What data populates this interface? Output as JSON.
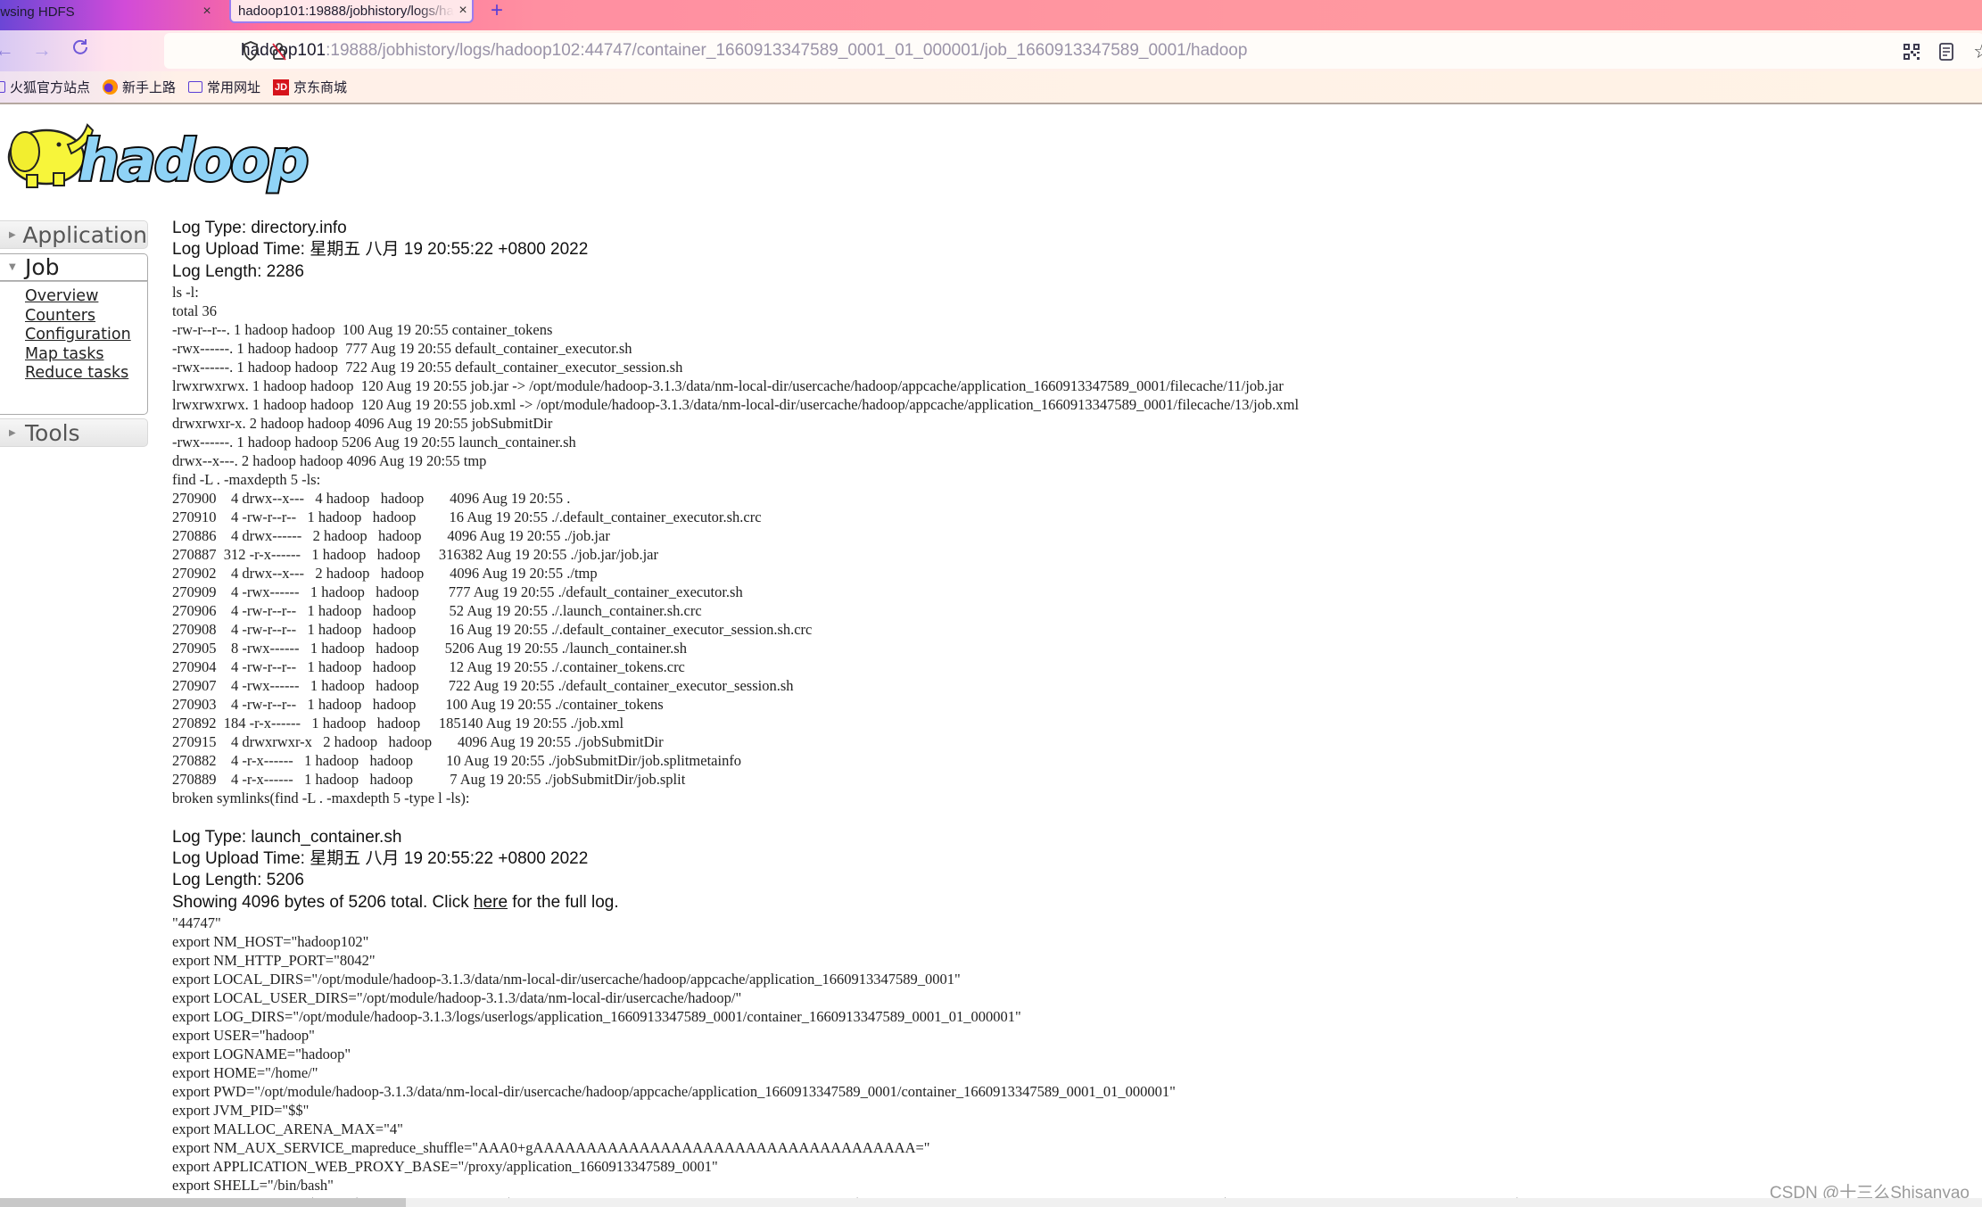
{
  "browser": {
    "tabs": [
      {
        "title": "owsing HDFS",
        "active": false
      },
      {
        "title": "hadoop101:19888/jobhistory/logs/hadoop102:44747/container_1660913347589_0001_01_000001/job_1660913347589_0001/hadoop",
        "active": true
      }
    ],
    "new_tab_label": "+",
    "close_glyph": "×",
    "url": {
      "host": "hadoop101",
      "path": ":19888/jobhistory/logs/hadoop102:44747/container_1660913347589_0001_01_000001/job_1660913347589_0001/hadoop"
    },
    "bookmarks": [
      {
        "label": "火狐官方站点",
        "icon": "folder-icon"
      },
      {
        "label": "新手上路",
        "icon": "firefox-icon"
      },
      {
        "label": "常用网址",
        "icon": "folder-icon"
      },
      {
        "label": "京东商城",
        "icon": "jd-icon",
        "icon_text": "JD"
      }
    ]
  },
  "sidebar": {
    "sections": [
      {
        "label": "Application",
        "expanded": false
      },
      {
        "label": "Job",
        "expanded": true,
        "links": [
          "Overview",
          "Counters",
          "Configuration",
          "Map tasks",
          "Reduce tasks"
        ]
      },
      {
        "label": "Tools",
        "expanded": false
      }
    ]
  },
  "logs": [
    {
      "type": "Log Type: directory.info",
      "upload_time": "Log Upload Time: 星期五 八月 19 20:55:22 +0800 2022",
      "length": "Log Length: 2286",
      "body": "ls -l:\ntotal 36\n-rw-r--r--. 1 hadoop hadoop  100 Aug 19 20:55 container_tokens\n-rwx------. 1 hadoop hadoop  777 Aug 19 20:55 default_container_executor.sh\n-rwx------. 1 hadoop hadoop  722 Aug 19 20:55 default_container_executor_session.sh\nlrwxrwxrwx. 1 hadoop hadoop  120 Aug 19 20:55 job.jar -> /opt/module/hadoop-3.1.3/data/nm-local-dir/usercache/hadoop/appcache/application_1660913347589_0001/filecache/11/job.jar\nlrwxrwxrwx. 1 hadoop hadoop  120 Aug 19 20:55 job.xml -> /opt/module/hadoop-3.1.3/data/nm-local-dir/usercache/hadoop/appcache/application_1660913347589_0001/filecache/13/job.xml\ndrwxrwxr-x. 2 hadoop hadoop 4096 Aug 19 20:55 jobSubmitDir\n-rwx------. 1 hadoop hadoop 5206 Aug 19 20:55 launch_container.sh\ndrwx--x---. 2 hadoop hadoop 4096 Aug 19 20:55 tmp\nfind -L . -maxdepth 5 -ls:\n270900    4 drwx--x---   4 hadoop   hadoop       4096 Aug 19 20:55 .\n270910    4 -rw-r--r--   1 hadoop   hadoop         16 Aug 19 20:55 ./.default_container_executor.sh.crc\n270886    4 drwx------   2 hadoop   hadoop       4096 Aug 19 20:55 ./job.jar\n270887  312 -r-x------   1 hadoop   hadoop     316382 Aug 19 20:55 ./job.jar/job.jar\n270902    4 drwx--x---   2 hadoop   hadoop       4096 Aug 19 20:55 ./tmp\n270909    4 -rwx------   1 hadoop   hadoop        777 Aug 19 20:55 ./default_container_executor.sh\n270906    4 -rw-r--r--   1 hadoop   hadoop         52 Aug 19 20:55 ./.launch_container.sh.crc\n270908    4 -rw-r--r--   1 hadoop   hadoop         16 Aug 19 20:55 ./.default_container_executor_session.sh.crc\n270905    8 -rwx------   1 hadoop   hadoop       5206 Aug 19 20:55 ./launch_container.sh\n270904    4 -rw-r--r--   1 hadoop   hadoop         12 Aug 19 20:55 ./.container_tokens.crc\n270907    4 -rwx------   1 hadoop   hadoop        722 Aug 19 20:55 ./default_container_executor_session.sh\n270903    4 -rw-r--r--   1 hadoop   hadoop        100 Aug 19 20:55 ./container_tokens\n270892  184 -r-x------   1 hadoop   hadoop     185140 Aug 19 20:55 ./job.xml\n270915    4 drwxrwxr-x   2 hadoop   hadoop       4096 Aug 19 20:55 ./jobSubmitDir\n270882    4 -r-x------   1 hadoop   hadoop         10 Aug 19 20:55 ./jobSubmitDir/job.splitmetainfo\n270889    4 -r-x------   1 hadoop   hadoop          7 Aug 19 20:55 ./jobSubmitDir/job.split\nbroken symlinks(find -L . -maxdepth 5 -type l -ls):"
    },
    {
      "type": "Log Type: launch_container.sh",
      "upload_time": "Log Upload Time: 星期五 八月 19 20:55:22 +0800 2022",
      "length": "Log Length: 5206",
      "showing_prefix": "Showing 4096 bytes of 5206 total. Click ",
      "showing_link": "here",
      "showing_suffix": " for the full log.",
      "body": "\"44747\"\nexport NM_HOST=\"hadoop102\"\nexport NM_HTTP_PORT=\"8042\"\nexport LOCAL_DIRS=\"/opt/module/hadoop-3.1.3/data/nm-local-dir/usercache/hadoop/appcache/application_1660913347589_0001\"\nexport LOCAL_USER_DIRS=\"/opt/module/hadoop-3.1.3/data/nm-local-dir/usercache/hadoop/\"\nexport LOG_DIRS=\"/opt/module/hadoop-3.1.3/logs/userlogs/application_1660913347589_0001/container_1660913347589_0001_01_000001\"\nexport USER=\"hadoop\"\nexport LOGNAME=\"hadoop\"\nexport HOME=\"/home/\"\nexport PWD=\"/opt/module/hadoop-3.1.3/data/nm-local-dir/usercache/hadoop/appcache/application_1660913347589_0001/container_1660913347589_0001_01_000001\"\nexport JVM_PID=\"$$\"\nexport MALLOC_ARENA_MAX=\"4\"\nexport NM_AUX_SERVICE_mapreduce_shuffle=\"AAA0+gAAAAAAAAAAAAAAAAAAAAAAAAAAAAAAAAAAAA=\"\nexport APPLICATION_WEB_PROXY_BASE=\"/proxy/application_1660913347589_0001\"\nexport SHELL=\"/bin/bash\"\nexport CLASSPATH=\"$PWD:$HADOOP_CONF_DIR:$HADOOP_COMMON_HOME/share/hadoop/common/*:$HADOOP_COMMON_HOME/share/hadoop/common/lib/*:$HADOOP_HDFS_HOME/share/hadoop/hdfs/*:$HADOOP_HDFS_HOME/share/hadoop/hdfs/lib/*:$HADOOP_YARN_HOME"
    }
  ],
  "watermark": "CSDN @十三么Shisanyao"
}
